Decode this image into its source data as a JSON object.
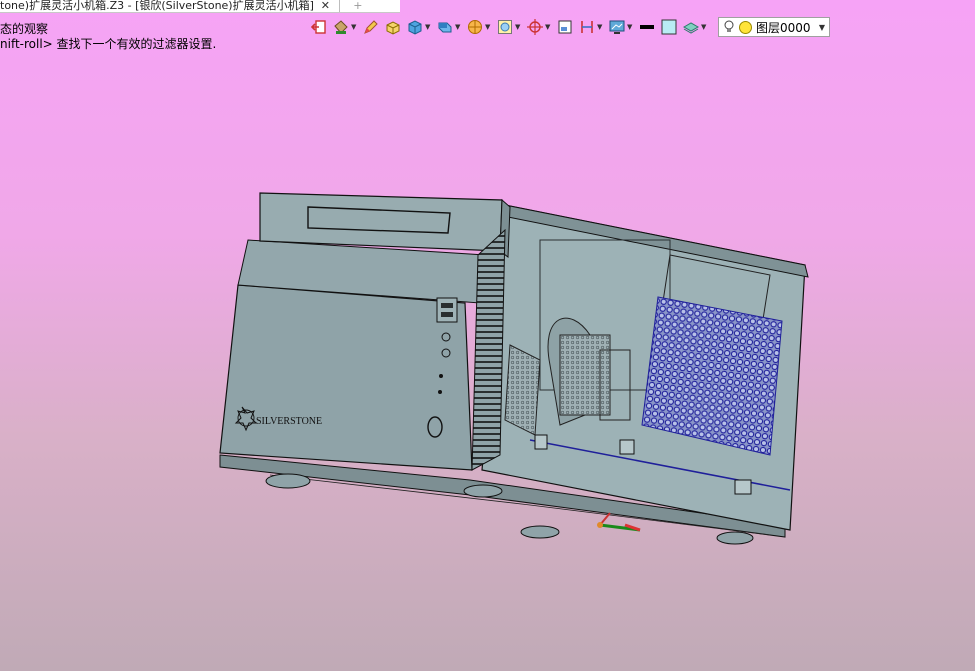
{
  "title_tab": {
    "text": "tone)扩展灵活小机箱.Z3 - [银欣(SilverStone)扩展灵活小机箱]",
    "close_glyph": "✕",
    "new_tab_glyph": "+"
  },
  "hints": {
    "line1": "态的观察",
    "line2": "nift-roll> 查找下一个有效的过滤器设置."
  },
  "toolbar": {
    "icons": [
      "exit-view-icon",
      "paint-bucket-icon",
      "pencil-icon",
      "box-select-icon",
      "cube-icon",
      "shaded-cube-icon",
      "sphere-icon",
      "transparent-box-icon",
      "crosshair-icon",
      "plane-icon",
      "section-icon",
      "monitor-icon",
      "line-color-icon",
      "fill-color-icon",
      "layer-stack-icon"
    ],
    "layer": {
      "label": "图层0000"
    }
  },
  "colors": {
    "background_top": "#f6a3f6",
    "background_bottom": "#c0aab6",
    "case_body": "#8fa3a8",
    "mesh": "#2a2aa0"
  },
  "model": {
    "brand_logo": "SILVERSTONE"
  }
}
